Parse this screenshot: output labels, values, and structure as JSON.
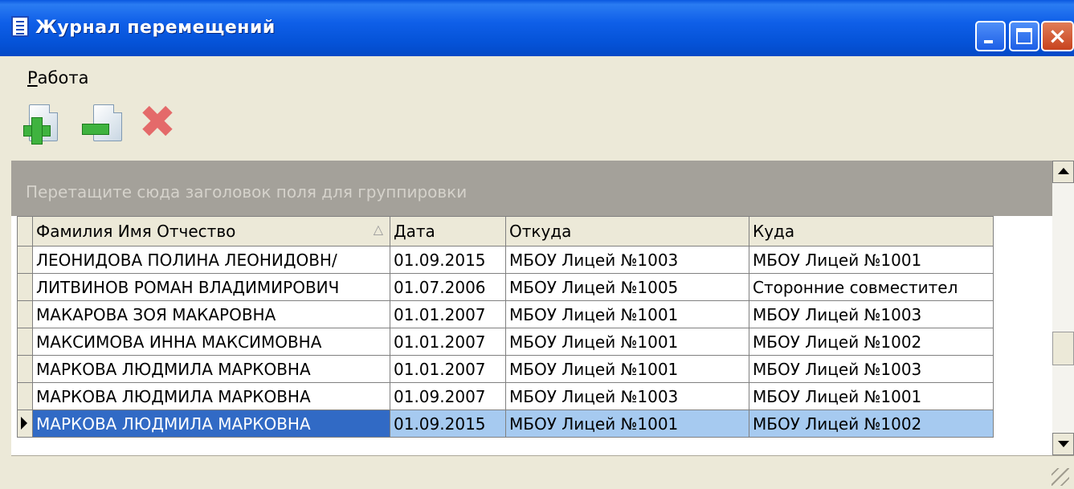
{
  "window": {
    "title": "Журнал перемещений",
    "controls": [
      "minimize-icon",
      "maximize-icon",
      "close-icon"
    ],
    "close_glyph": "×"
  },
  "menu": {
    "items": [
      {
        "accel": "Р",
        "rest": "абота"
      }
    ]
  },
  "toolbar": {
    "buttons": [
      "add-document-icon",
      "remove-document-icon",
      "delete-icon"
    ],
    "delete_glyph": "✖"
  },
  "grid": {
    "group_hint": "Перетащите сюда заголовок поля для группировки",
    "sort_glyph": "△",
    "columns": [
      "Фамилия Имя Отчество",
      "Дата",
      "Откуда",
      "Куда"
    ],
    "rows": [
      {
        "name": "ЛЕОНИДОВА ПОЛИНА ЛЕОНИДОВН/",
        "date": "01.09.2015",
        "from": "МБОУ Лицей №1003",
        "to": "МБОУ Лицей №1001"
      },
      {
        "name": "ЛИТВИНОВ РОМАН ВЛАДИМИРОВИЧ",
        "date": "01.07.2006",
        "from": "МБОУ Лицей №1005",
        "to": "Сторонние совместител"
      },
      {
        "name": "МАКАРОВА ЗОЯ МАКАРОВНА",
        "date": "01.01.2007",
        "from": "МБОУ Лицей №1001",
        "to": "МБОУ Лицей №1003"
      },
      {
        "name": "МАКСИМОВА ИННА МАКСИМОВНА",
        "date": "01.01.2007",
        "from": "МБОУ Лицей №1001",
        "to": "МБОУ Лицей №1002"
      },
      {
        "name": "МАРКОВА ЛЮДМИЛА МАРКОВНА",
        "date": "01.01.2007",
        "from": "МБОУ Лицей №1001",
        "to": "МБОУ Лицей №1003"
      },
      {
        "name": "МАРКОВА ЛЮДМИЛА МАРКОВНА",
        "date": "01.09.2007",
        "from": "МБОУ Лицей №1003",
        "to": "МБОУ Лицей №1001"
      },
      {
        "name": "МАРКОВА ЛЮДМИЛА МАРКОВНА",
        "date": "01.09.2015",
        "from": "МБОУ Лицей №1001",
        "to": "МБОУ Лицей №1002"
      }
    ],
    "selected_row": 6
  },
  "colors": {
    "titlebar": "#0553d8",
    "selection": "#316ac5",
    "selection_light": "#a6caf0",
    "window_bg": "#ece9d8",
    "group_panel": "#a4a19a"
  }
}
